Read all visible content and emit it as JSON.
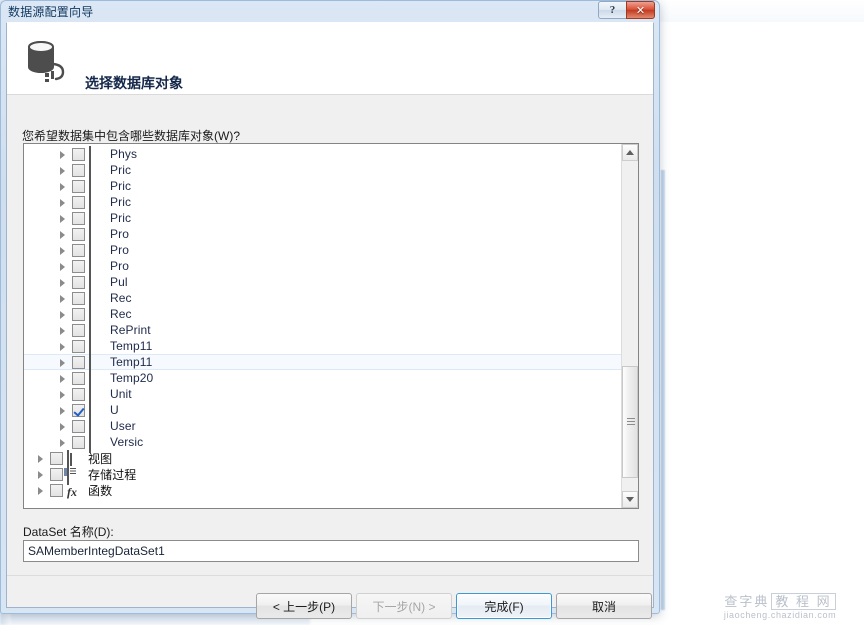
{
  "window": {
    "title": "数据源配置向导",
    "help_button": "?",
    "close_button": "✕"
  },
  "header": {
    "title": "选择数据库对象",
    "icon": "database-server-icon"
  },
  "body": {
    "prompt": "您希望数据集中包含哪些数据库对象(W)?",
    "dataset_label": "DataSet 名称(D):",
    "dataset_value": "SAMemberIntegDataSet1"
  },
  "tree": {
    "items": [
      {
        "label": "Phys",
        "icon": "table-icon",
        "checked": false,
        "level": 2,
        "highlighted": false
      },
      {
        "label": "Pric",
        "icon": "table-icon",
        "checked": false,
        "level": 2,
        "highlighted": false
      },
      {
        "label": "Pric",
        "icon": "table-icon",
        "checked": false,
        "level": 2,
        "highlighted": false
      },
      {
        "label": "Pric",
        "icon": "table-icon",
        "checked": false,
        "level": 2,
        "highlighted": false
      },
      {
        "label": "Pric",
        "icon": "table-icon",
        "checked": false,
        "level": 2,
        "highlighted": false
      },
      {
        "label": "Pro",
        "icon": "table-icon",
        "checked": false,
        "level": 2,
        "highlighted": false
      },
      {
        "label": "Pro",
        "icon": "table-icon",
        "checked": false,
        "level": 2,
        "highlighted": false
      },
      {
        "label": "Pro",
        "icon": "table-icon",
        "checked": false,
        "level": 2,
        "highlighted": false
      },
      {
        "label": "Pul",
        "icon": "table-icon",
        "checked": false,
        "level": 2,
        "highlighted": false
      },
      {
        "label": "Rec",
        "icon": "table-icon",
        "checked": false,
        "level": 2,
        "highlighted": false
      },
      {
        "label": "Rec",
        "icon": "table-icon",
        "checked": false,
        "level": 2,
        "highlighted": false
      },
      {
        "label": "RePrint",
        "icon": "table-icon",
        "checked": false,
        "level": 2,
        "highlighted": false
      },
      {
        "label": "Temp11",
        "icon": "table-icon",
        "checked": false,
        "level": 2,
        "highlighted": false
      },
      {
        "label": "Temp11",
        "icon": "table-icon",
        "checked": false,
        "level": 2,
        "highlighted": true
      },
      {
        "label": "Temp20",
        "icon": "table-icon",
        "checked": false,
        "level": 2,
        "highlighted": false
      },
      {
        "label": "Unit",
        "icon": "table-icon",
        "checked": false,
        "level": 2,
        "highlighted": false
      },
      {
        "label": "U",
        "icon": "table-icon",
        "checked": true,
        "level": 2,
        "highlighted": false
      },
      {
        "label": "User",
        "icon": "table-icon",
        "checked": false,
        "level": 2,
        "highlighted": false
      },
      {
        "label": "Versic",
        "icon": "table-icon",
        "checked": false,
        "level": 2,
        "highlighted": false
      },
      {
        "label": "视图",
        "icon": "view-icon",
        "checked": false,
        "level": 1,
        "highlighted": false
      },
      {
        "label": "存储过程",
        "icon": "stored-proc-icon",
        "checked": false,
        "level": 1,
        "highlighted": false
      },
      {
        "label": "函数",
        "icon": "function-fx-icon",
        "checked": false,
        "level": 1,
        "highlighted": false
      }
    ],
    "scrollbar": {
      "up_arrow": "▲",
      "down_arrow": "▼"
    }
  },
  "buttons": {
    "previous": "< 上一步(P)",
    "next": "下一步(N) >",
    "finish": "完成(F)",
    "cancel": "取消"
  },
  "watermark": {
    "line1_a": "查字典",
    "line1_b": "教 程 网",
    "line2": "jiaocheng.chazidian.com"
  },
  "colors": {
    "accent_blue": "#3c99d4",
    "close_red": "#c23a21",
    "title_text": "#11375f",
    "check_blue": "#2160c4"
  }
}
